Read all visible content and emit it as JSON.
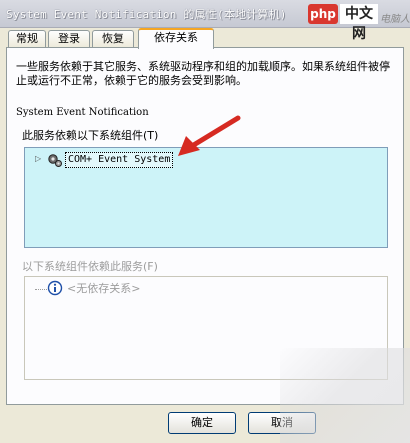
{
  "window": {
    "title": "System Event Notification 的属性(本地计算机)",
    "logo_php": "php",
    "logo_cn": "中文网",
    "logo_watermark": "电脑人人有"
  },
  "tabs": [
    {
      "label": "常规",
      "active": false
    },
    {
      "label": "登录",
      "active": false
    },
    {
      "label": "恢复",
      "active": false
    },
    {
      "label": "依存关系",
      "active": true
    }
  ],
  "dependencies": {
    "description": "一些服务依赖于其它服务、系统驱动程序和组的加载顺序。如果系统组件被停止或运行不正常，依赖于它的服务会受到影响。",
    "service_name": "System Event Notification",
    "depends_on_label": "此服务依赖以下系统组件(T)",
    "depends_on_items": [
      {
        "label": "COM+ Event System",
        "icon": "gear-icon"
      }
    ],
    "dependents_label": "以下系统组件依赖此服务(F)",
    "dependents_items": [
      {
        "label": "<无依存关系>",
        "icon": "info-icon"
      }
    ]
  },
  "buttons": {
    "ok": "确定",
    "cancel": "取消"
  },
  "colors": {
    "active_tab_accent": "#f5a623",
    "list_background": "#cdf3f8",
    "arrow": "#d62a22"
  }
}
